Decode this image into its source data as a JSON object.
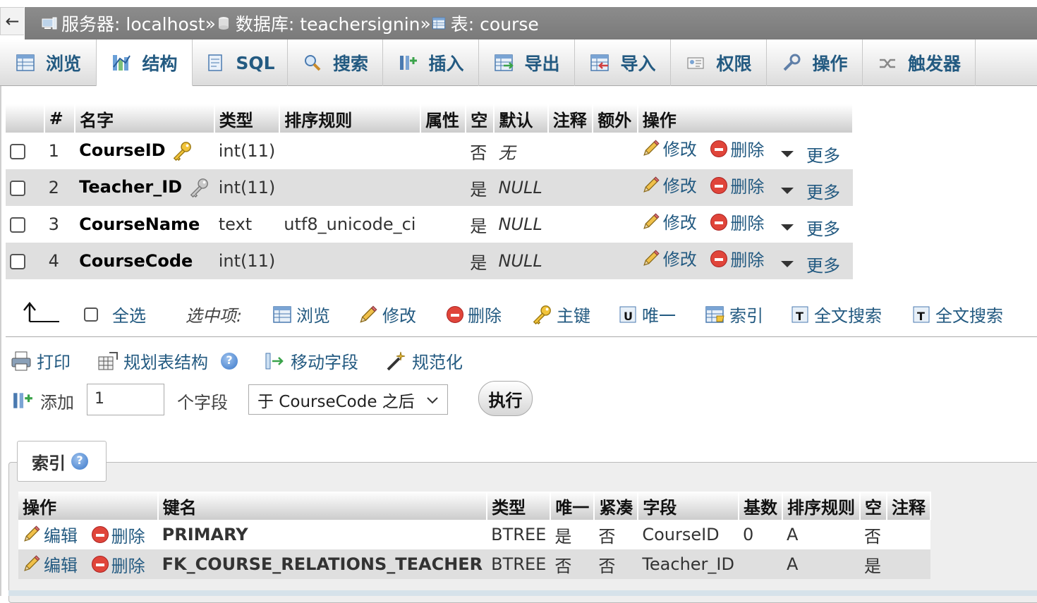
{
  "breadcrumb": {
    "back_symbol": "←",
    "server": "服务器: localhost",
    "database": "数据库: teachersignin",
    "table": "表: course",
    "separator": "»"
  },
  "tabs": [
    {
      "label": "浏览",
      "icon": "browse-icon"
    },
    {
      "label": "结构",
      "icon": "structure-icon",
      "active": true
    },
    {
      "label": "SQL",
      "icon": "sql-icon"
    },
    {
      "label": "搜索",
      "icon": "search-icon"
    },
    {
      "label": "插入",
      "icon": "insert-icon"
    },
    {
      "label": "导出",
      "icon": "export-icon"
    },
    {
      "label": "导入",
      "icon": "import-icon"
    },
    {
      "label": "权限",
      "icon": "privileges-icon"
    },
    {
      "label": "操作",
      "icon": "operations-icon"
    },
    {
      "label": "触发器",
      "icon": "triggers-icon"
    }
  ],
  "fields_table": {
    "headers": {
      "num": "#",
      "name": "名字",
      "type": "类型",
      "collation": "排序规则",
      "attributes": "属性",
      "null": "空",
      "default": "默认",
      "comment": "注释",
      "extra": "额外",
      "action": "操作"
    },
    "rows": [
      {
        "num": "1",
        "name": "CourseID",
        "type": "int(11)",
        "collation": "",
        "attributes": "",
        "null": "否",
        "default": "无",
        "key_icon": "primary-key-icon"
      },
      {
        "num": "2",
        "name": "Teacher_ID",
        "type": "int(11)",
        "collation": "",
        "attributes": "",
        "null": "是",
        "default": "NULL",
        "key_icon": "foreign-key-icon"
      },
      {
        "num": "3",
        "name": "CourseName",
        "type": "text",
        "collation": "utf8_unicode_ci",
        "attributes": "",
        "null": "是",
        "default": "NULL"
      },
      {
        "num": "4",
        "name": "CourseCode",
        "type": "int(11)",
        "collation": "",
        "attributes": "",
        "null": "是",
        "default": "NULL"
      }
    ],
    "actions": {
      "change": "修改",
      "drop": "删除",
      "more": "更多"
    }
  },
  "with_selected": {
    "check_all": "全选",
    "label": "选中项:",
    "items": [
      "浏览",
      "修改",
      "删除",
      "主键",
      "唯一",
      "索引",
      "全文搜索",
      "全文搜索"
    ]
  },
  "tools": {
    "print": "打印",
    "propose": "规划表结构",
    "move": "移动字段",
    "normalize": "规范化"
  },
  "add_field": {
    "label": "添加",
    "count": "1",
    "suffix": "个字段",
    "position": "于 CourseCode 之后",
    "go": "执行"
  },
  "indexes": {
    "legend": "索引",
    "headers": {
      "action": "操作",
      "keyname": "键名",
      "type": "类型",
      "unique": "唯一",
      "packed": "紧凑",
      "column": "字段",
      "cardinality": "基数",
      "collation": "排序规则",
      "null": "空",
      "comment": "注释"
    },
    "actions": {
      "edit": "编辑",
      "drop": "删除"
    },
    "rows": [
      {
        "keyname": "PRIMARY",
        "type": "BTREE",
        "unique": "是",
        "packed": "否",
        "column": "CourseID",
        "cardinality": "0",
        "collation": "A",
        "null": "否",
        "comment": ""
      },
      {
        "keyname": "FK_COURSE_RELATIONS_TEACHER",
        "type": "BTREE",
        "unique": "否",
        "packed": "否",
        "column": "Teacher_ID",
        "cardinality": "",
        "collation": "A",
        "null": "是",
        "comment": ""
      }
    ]
  },
  "colors": {
    "link": "#235a81",
    "header_bar": "#828282",
    "row_alt": "#dfdfdf",
    "danger": "#e0453a"
  }
}
